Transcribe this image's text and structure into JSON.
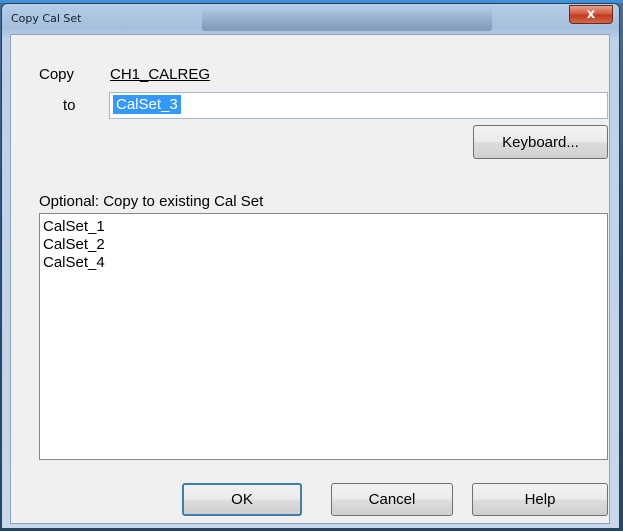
{
  "window": {
    "title": "Copy Cal Set",
    "close_glyph": "x"
  },
  "form": {
    "copy_label": "Copy",
    "source_name": "CH1_CALREG",
    "to_label": "to",
    "to_value": "CalSet_3",
    "keyboard_button": "Keyboard...",
    "optional_label": "Optional: Copy to existing Cal Set"
  },
  "list": {
    "items": [
      "CalSet_1",
      "CalSet_2",
      "CalSet_4"
    ]
  },
  "buttons": {
    "ok": "OK",
    "cancel": "Cancel",
    "help": "Help"
  },
  "colors": {
    "selection": "#3399ff",
    "close_button": "#c23b20",
    "dialog_face": "#f0f0f0"
  }
}
